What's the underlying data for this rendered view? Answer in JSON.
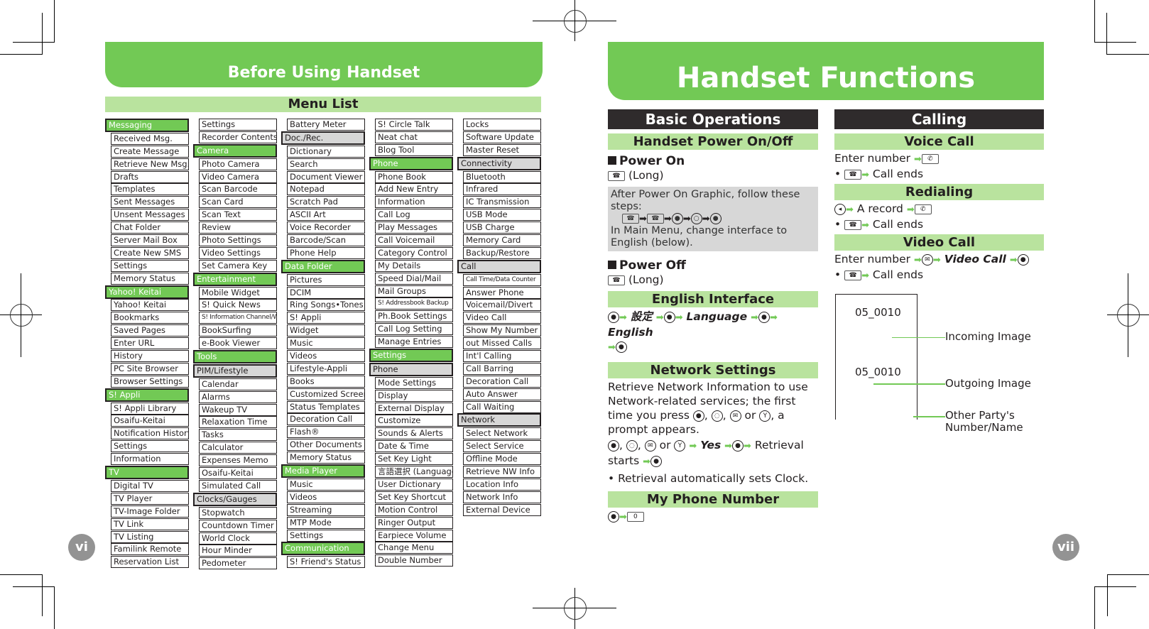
{
  "left_page": {
    "tab_title": "Before Using Handset",
    "section_title": "Menu List",
    "page_number": "vi",
    "columns": [
      [
        {
          "label": "Messaging",
          "type": "green"
        },
        {
          "label": "Received Msg."
        },
        {
          "label": "Create Message"
        },
        {
          "label": "Retrieve New Msg."
        },
        {
          "label": "Drafts"
        },
        {
          "label": "Templates"
        },
        {
          "label": "Sent Messages"
        },
        {
          "label": "Unsent Messages"
        },
        {
          "label": "Chat Folder"
        },
        {
          "label": "Server Mail Box"
        },
        {
          "label": "Create New SMS"
        },
        {
          "label": "Settings"
        },
        {
          "label": "Memory Status"
        },
        {
          "label": "Yahoo! Keitai",
          "type": "green"
        },
        {
          "label": "Yahoo! Keitai"
        },
        {
          "label": "Bookmarks"
        },
        {
          "label": "Saved Pages"
        },
        {
          "label": "Enter URL"
        },
        {
          "label": "History"
        },
        {
          "label": "PC Site Browser"
        },
        {
          "label": "Browser Settings"
        },
        {
          "label": "S! Appli",
          "type": "green"
        },
        {
          "label": "S! Appli Library"
        },
        {
          "label": "Osaifu-Keitai"
        },
        {
          "label": "Notification History"
        },
        {
          "label": "Settings"
        },
        {
          "label": "Information"
        },
        {
          "label": "TV",
          "type": "green"
        },
        {
          "label": "Digital TV"
        },
        {
          "label": "TV Player"
        },
        {
          "label": "TV-Image Folder"
        },
        {
          "label": "TV Link"
        },
        {
          "label": "TV Listing"
        },
        {
          "label": "Familink Remote"
        },
        {
          "label": "Reservation List"
        }
      ],
      [
        {
          "label": "Settings"
        },
        {
          "label": "Recorder Contents"
        },
        {
          "label": "Camera",
          "type": "green"
        },
        {
          "label": "Photo Camera"
        },
        {
          "label": "Video Camera"
        },
        {
          "label": "Scan Barcode"
        },
        {
          "label": "Scan Card"
        },
        {
          "label": "Scan Text"
        },
        {
          "label": "Review"
        },
        {
          "label": "Photo Settings"
        },
        {
          "label": "Video Settings"
        },
        {
          "label": "Set Camera Key"
        },
        {
          "label": "Entertainment",
          "type": "green"
        },
        {
          "label": "Mobile Widget"
        },
        {
          "label": "S! Quick News"
        },
        {
          "label": "S! Information Channel/Weather",
          "type": "small"
        },
        {
          "label": "BookSurfing"
        },
        {
          "label": "e-Book Viewer"
        },
        {
          "label": "Tools",
          "type": "green"
        },
        {
          "label": "PIM/Lifestyle",
          "type": "gray"
        },
        {
          "label": "Calendar"
        },
        {
          "label": "Alarms"
        },
        {
          "label": "Wakeup TV"
        },
        {
          "label": "Relaxation Time"
        },
        {
          "label": "Tasks"
        },
        {
          "label": "Calculator"
        },
        {
          "label": "Expenses Memo"
        },
        {
          "label": "Osaifu-Keitai"
        },
        {
          "label": "Simulated Call"
        },
        {
          "label": "Clocks/Gauges",
          "type": "gray"
        },
        {
          "label": "Stopwatch"
        },
        {
          "label": "Countdown Timer"
        },
        {
          "label": "World Clock"
        },
        {
          "label": "Hour Minder"
        },
        {
          "label": "Pedometer"
        }
      ],
      [
        {
          "label": "Battery Meter"
        },
        {
          "label": "Doc./Rec.",
          "type": "gray"
        },
        {
          "label": "Dictionary"
        },
        {
          "label": "Search"
        },
        {
          "label": "Document Viewer"
        },
        {
          "label": "Notepad"
        },
        {
          "label": "Scratch Pad"
        },
        {
          "label": "ASCII Art"
        },
        {
          "label": "Voice Recorder"
        },
        {
          "label": "Barcode/Scan"
        },
        {
          "label": "Phone Help"
        },
        {
          "label": "Data Folder",
          "type": "green"
        },
        {
          "label": "Pictures"
        },
        {
          "label": "DCIM"
        },
        {
          "label": "Ring Songs•Tones"
        },
        {
          "label": "S! Appli"
        },
        {
          "label": "Widget"
        },
        {
          "label": "Music"
        },
        {
          "label": "Videos"
        },
        {
          "label": "Lifestyle-Appli"
        },
        {
          "label": "Books"
        },
        {
          "label": "Customized Screen"
        },
        {
          "label": "Status Templates"
        },
        {
          "label": "Decoration Call"
        },
        {
          "label": "Flash®"
        },
        {
          "label": "Other Documents"
        },
        {
          "label": "Memory Status"
        },
        {
          "label": "Media Player",
          "type": "green"
        },
        {
          "label": "Music"
        },
        {
          "label": "Videos"
        },
        {
          "label": "Streaming"
        },
        {
          "label": "MTP Mode"
        },
        {
          "label": "Settings"
        },
        {
          "label": "Communication",
          "type": "green"
        },
        {
          "label": "S! Friend's Status"
        }
      ],
      [
        {
          "label": "S! Circle Talk"
        },
        {
          "label": "Neat chat"
        },
        {
          "label": "Blog Tool"
        },
        {
          "label": "Phone",
          "type": "green"
        },
        {
          "label": "Phone Book"
        },
        {
          "label": "Add New Entry"
        },
        {
          "label": "Information"
        },
        {
          "label": "Call Log"
        },
        {
          "label": "Play Messages"
        },
        {
          "label": "Call Voicemail"
        },
        {
          "label": "Category Control"
        },
        {
          "label": "My Details"
        },
        {
          "label": "Speed Dial/Mail"
        },
        {
          "label": "Mail Groups"
        },
        {
          "label": "S! Addressbook Backup",
          "type": "small"
        },
        {
          "label": "Ph.Book Settings"
        },
        {
          "label": "Call Log Setting"
        },
        {
          "label": "Manage Entries"
        },
        {
          "label": "Settings",
          "type": "green"
        },
        {
          "label": "Phone",
          "type": "gray"
        },
        {
          "label": "Mode Settings"
        },
        {
          "label": "Display"
        },
        {
          "label": "External Display"
        },
        {
          "label": "Customize"
        },
        {
          "label": "Sounds & Alerts"
        },
        {
          "label": "Date & Time"
        },
        {
          "label": "Set Key Light"
        },
        {
          "label": "言語選択 (Language)"
        },
        {
          "label": "User Dictionary"
        },
        {
          "label": "Set Key Shortcut"
        },
        {
          "label": "Motion Control"
        },
        {
          "label": "Ringer Output"
        },
        {
          "label": "Earpiece Volume"
        },
        {
          "label": "Change Menu"
        },
        {
          "label": "Double Number"
        }
      ],
      [
        {
          "label": "Locks"
        },
        {
          "label": "Software Update"
        },
        {
          "label": "Master Reset"
        },
        {
          "label": "Connectivity",
          "type": "gray"
        },
        {
          "label": "Bluetooth"
        },
        {
          "label": "Infrared"
        },
        {
          "label": "IC Transmission"
        },
        {
          "label": "USB Mode"
        },
        {
          "label": "USB Charge"
        },
        {
          "label": "Memory Card"
        },
        {
          "label": "Backup/Restore"
        },
        {
          "label": "Call",
          "type": "gray"
        },
        {
          "label": "Call Time/Data Counter",
          "type": "small"
        },
        {
          "label": "Answer Phone"
        },
        {
          "label": "Voicemail/Divert"
        },
        {
          "label": "Video Call"
        },
        {
          "label": "Show My Number"
        },
        {
          "label": "out Missed Calls"
        },
        {
          "label": "Int'l Calling"
        },
        {
          "label": "Call Barring"
        },
        {
          "label": "Decoration Call"
        },
        {
          "label": "Auto Answer"
        },
        {
          "label": "Call Waiting"
        },
        {
          "label": "Network",
          "type": "gray"
        },
        {
          "label": "Select Network"
        },
        {
          "label": "Select Service"
        },
        {
          "label": "Offline Mode"
        },
        {
          "label": "Retrieve NW Info"
        },
        {
          "label": "Location Info"
        },
        {
          "label": "Network Info"
        },
        {
          "label": "External Device"
        }
      ]
    ]
  },
  "right_page": {
    "tab_title": "Handset Functions",
    "page_number": "vii",
    "basic_operations": {
      "title": "Basic Operations",
      "power_section": "Handset Power On/Off",
      "power_on_heading": "Power On",
      "power_on_step": "(Long)",
      "note_line1": "After Power On Graphic, follow these steps:",
      "note_line3": "In Main Menu, change interface to English (below).",
      "power_off_heading": "Power Off",
      "power_off_step": "(Long)",
      "english_section": "English Interface",
      "english_step_1": "設定",
      "english_step_2": "Language",
      "english_step_3": "English",
      "network_section": "Network Settings",
      "network_text": "Retrieve Network Information to use Network-related services; the first time you press",
      "network_text_end": "a prompt appears.",
      "network_or": "or",
      "network_yes": "Yes",
      "network_retrieval": "Retrieval starts",
      "network_bullet": "Retrieval automatically sets Clock.",
      "my_number_section": "My Phone Number"
    },
    "calling": {
      "title": "Calling",
      "voice_call_section": "Voice Call",
      "voice_call_step": "Enter number",
      "call_ends": "Call ends",
      "redialing_section": "Redialing",
      "redialing_step": "A record",
      "video_call_section": "Video Call",
      "video_call_step": "Enter number",
      "video_call_item": "Video Call",
      "diagram": {
        "label_top": "05_0010",
        "label_bottom": "05_0010",
        "callout_incoming": "Incoming Image",
        "callout_outgoing": "Outgoing Image",
        "callout_other_party": "Other Party's Number/Name"
      }
    }
  },
  "colors": {
    "green": "#72c955",
    "light_green": "#b9e39e",
    "gray_category": "#d7d7d7",
    "dark_bar": "#2f2b2c",
    "page_badge": "#939393"
  }
}
